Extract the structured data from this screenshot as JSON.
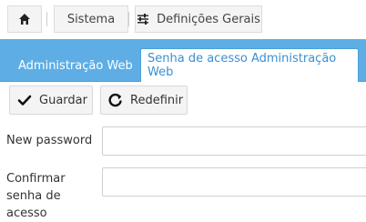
{
  "breadcrumb": {
    "home_icon": "home-icon",
    "items": [
      {
        "label": "Sistema"
      },
      {
        "label": "Definições Gerais",
        "icon": "sliders-icon"
      }
    ]
  },
  "tabs": [
    {
      "label": "Administração Web",
      "active": false
    },
    {
      "label": "Senha de acesso Administração Web",
      "active": true
    }
  ],
  "toolbar": {
    "save": {
      "label": "Guardar",
      "icon": "checkmark-icon"
    },
    "reset": {
      "label": "Redefinir",
      "icon": "refresh-icon"
    }
  },
  "form": {
    "new_password": {
      "label": "New password",
      "value": ""
    },
    "confirm_password": {
      "label": "Confirmar senha de acesso",
      "value": ""
    }
  },
  "colors": {
    "tab_bar": "#5eaee5",
    "active_tab_text": "#3a8fd1",
    "button_bg": "#f4f4f4"
  }
}
